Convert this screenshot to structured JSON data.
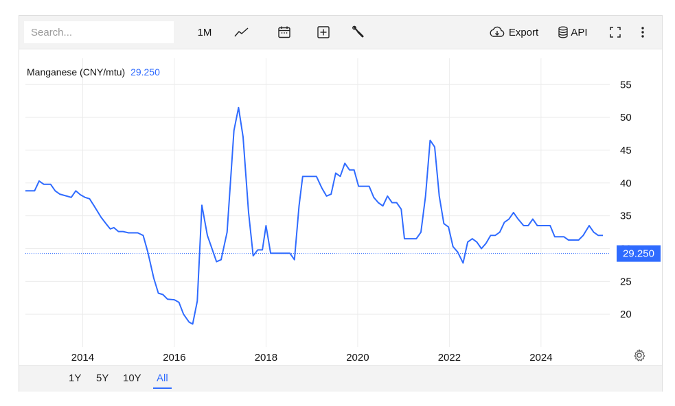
{
  "toolbar": {
    "search_placeholder": "Search...",
    "interval_label": "1M",
    "export_label": "Export",
    "api_label": "API",
    "icons": [
      "line-chart-icon",
      "calendar-icon",
      "plus-box-icon",
      "wrench-icon",
      "cloud-download-icon",
      "database-icon",
      "fullscreen-icon",
      "more-vertical-icon"
    ]
  },
  "range_buttons": [
    {
      "label": "1Y",
      "active": false
    },
    {
      "label": "5Y",
      "active": false
    },
    {
      "label": "10Y",
      "active": false
    },
    {
      "label": "All",
      "active": true
    }
  ],
  "colors": {
    "line": "#2f6bff",
    "last_value_bg": "#2f6bff",
    "grid": "#ececec"
  },
  "chart_data": {
    "type": "line",
    "legend_name": "Manganese (CNY/mtu)",
    "last_value": "29.250",
    "y_axis_position": "right",
    "grid": true,
    "ylim": [
      15,
      59
    ],
    "y_ticks": [
      20,
      25,
      30,
      35,
      40,
      45,
      50,
      55
    ],
    "x_range": [
      2012.75,
      2025.5
    ],
    "x_ticks": [
      "2014",
      "2016",
      "2018",
      "2020",
      "2022",
      "2024"
    ],
    "series": [
      {
        "name": "Manganese (CNY/mtu)",
        "points": [
          [
            2012.75,
            38.8
          ],
          [
            2012.95,
            38.8
          ],
          [
            2013.05,
            40.3
          ],
          [
            2013.15,
            39.8
          ],
          [
            2013.3,
            39.8
          ],
          [
            2013.4,
            38.8
          ],
          [
            2013.5,
            38.3
          ],
          [
            2013.65,
            38.0
          ],
          [
            2013.75,
            37.8
          ],
          [
            2013.85,
            38.8
          ],
          [
            2013.95,
            38.2
          ],
          [
            2014.05,
            37.8
          ],
          [
            2014.15,
            37.6
          ],
          [
            2014.25,
            36.5
          ],
          [
            2014.4,
            34.8
          ],
          [
            2014.52,
            33.7
          ],
          [
            2014.6,
            33.0
          ],
          [
            2014.68,
            33.2
          ],
          [
            2014.78,
            32.6
          ],
          [
            2014.88,
            32.6
          ],
          [
            2015.0,
            32.4
          ],
          [
            2015.2,
            32.4
          ],
          [
            2015.32,
            32.0
          ],
          [
            2015.42,
            29.5
          ],
          [
            2015.55,
            25.5
          ],
          [
            2015.65,
            23.2
          ],
          [
            2015.75,
            23.0
          ],
          [
            2015.85,
            22.3
          ],
          [
            2016.0,
            22.2
          ],
          [
            2016.1,
            21.8
          ],
          [
            2016.2,
            20.0
          ],
          [
            2016.32,
            18.8
          ],
          [
            2016.4,
            18.5
          ],
          [
            2016.5,
            22.0
          ],
          [
            2016.6,
            36.6
          ],
          [
            2016.72,
            32.0
          ],
          [
            2016.82,
            30.0
          ],
          [
            2016.92,
            28.0
          ],
          [
            2017.02,
            28.3
          ],
          [
            2017.15,
            32.5
          ],
          [
            2017.3,
            48.0
          ],
          [
            2017.4,
            51.5
          ],
          [
            2017.5,
            47.0
          ],
          [
            2017.62,
            35.5
          ],
          [
            2017.72,
            28.9
          ],
          [
            2017.82,
            29.8
          ],
          [
            2017.92,
            29.8
          ],
          [
            2018.0,
            33.5
          ],
          [
            2018.1,
            29.3
          ],
          [
            2018.22,
            29.3
          ],
          [
            2018.4,
            29.3
          ],
          [
            2018.52,
            29.3
          ],
          [
            2018.62,
            28.3
          ],
          [
            2018.72,
            36.5
          ],
          [
            2018.8,
            41.0
          ],
          [
            2018.9,
            41.0
          ],
          [
            2019.1,
            41.0
          ],
          [
            2019.22,
            39.2
          ],
          [
            2019.32,
            38.0
          ],
          [
            2019.42,
            38.3
          ],
          [
            2019.52,
            41.5
          ],
          [
            2019.62,
            41.0
          ],
          [
            2019.72,
            43.0
          ],
          [
            2019.82,
            42.0
          ],
          [
            2019.92,
            42.0
          ],
          [
            2020.02,
            39.5
          ],
          [
            2020.15,
            39.5
          ],
          [
            2020.25,
            39.5
          ],
          [
            2020.35,
            37.8
          ],
          [
            2020.45,
            37.0
          ],
          [
            2020.55,
            36.5
          ],
          [
            2020.65,
            38.0
          ],
          [
            2020.75,
            37.0
          ],
          [
            2020.85,
            37.0
          ],
          [
            2020.95,
            36.0
          ],
          [
            2021.02,
            31.5
          ],
          [
            2021.2,
            31.5
          ],
          [
            2021.28,
            31.5
          ],
          [
            2021.38,
            32.5
          ],
          [
            2021.48,
            38.0
          ],
          [
            2021.58,
            46.5
          ],
          [
            2021.68,
            45.5
          ],
          [
            2021.78,
            38.0
          ],
          [
            2021.88,
            33.8
          ],
          [
            2021.98,
            33.3
          ],
          [
            2022.08,
            30.3
          ],
          [
            2022.18,
            29.5
          ],
          [
            2022.3,
            27.8
          ],
          [
            2022.4,
            31.0
          ],
          [
            2022.5,
            31.5
          ],
          [
            2022.6,
            31.0
          ],
          [
            2022.7,
            30.0
          ],
          [
            2022.8,
            30.8
          ],
          [
            2022.9,
            32.0
          ],
          [
            2023.0,
            32.0
          ],
          [
            2023.1,
            32.5
          ],
          [
            2023.2,
            34.0
          ],
          [
            2023.3,
            34.5
          ],
          [
            2023.4,
            35.5
          ],
          [
            2023.5,
            34.5
          ],
          [
            2023.62,
            33.5
          ],
          [
            2023.72,
            33.5
          ],
          [
            2023.82,
            34.5
          ],
          [
            2023.92,
            33.5
          ],
          [
            2024.2,
            33.5
          ],
          [
            2024.3,
            31.8
          ],
          [
            2024.5,
            31.8
          ],
          [
            2024.6,
            31.3
          ],
          [
            2024.82,
            31.3
          ],
          [
            2024.92,
            32.0
          ],
          [
            2025.05,
            33.5
          ],
          [
            2025.15,
            32.5
          ],
          [
            2025.25,
            32.0
          ],
          [
            2025.35,
            32.0
          ]
        ]
      }
    ]
  }
}
